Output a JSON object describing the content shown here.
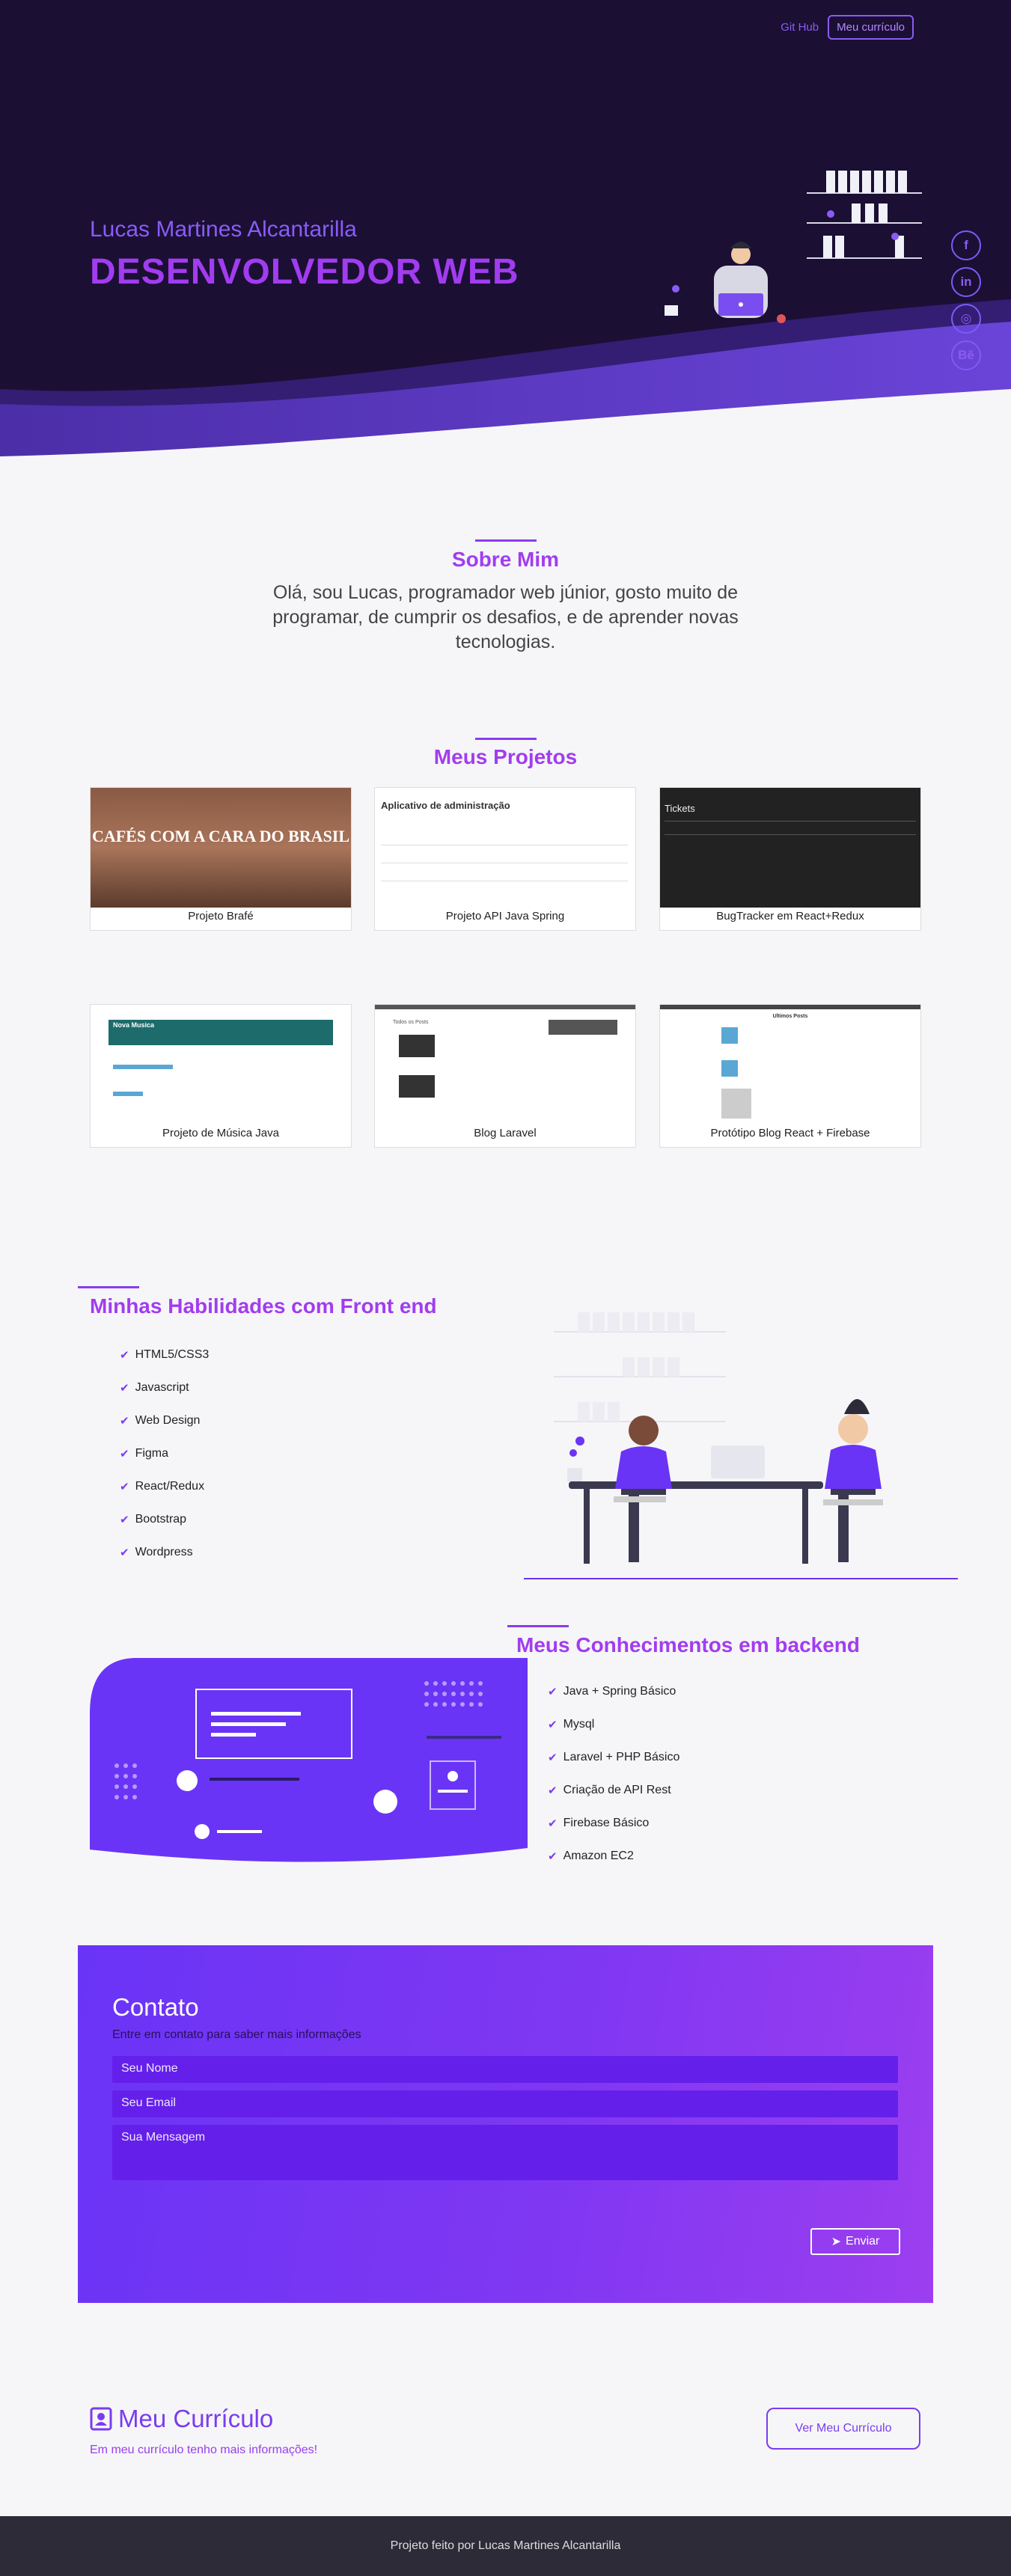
{
  "nav": {
    "github": "Git Hub",
    "curriculo": "Meu currículo"
  },
  "hero": {
    "name": "Lucas Martines Alcantarilla",
    "title": "DESENVOLVEDOR WEB"
  },
  "social": [
    {
      "label": "f",
      "icon": "facebook-icon"
    },
    {
      "label": "in",
      "icon": "linkedin-icon"
    },
    {
      "label": "◎",
      "icon": "whatsapp-icon"
    },
    {
      "label": "Bē",
      "icon": "behance-icon"
    }
  ],
  "about": {
    "title": "Sobre Mim",
    "text": "Olá, sou Lucas, programador web júnior, gosto muito de programar, de cumprir os desafios, e de aprender novas tecnologias."
  },
  "projects": {
    "title": "Meus Projetos",
    "items": [
      {
        "caption": "Projeto Brafé",
        "thumb_text": "CAFÉS COM A CARA DO BRASIL"
      },
      {
        "caption": "Projeto API Java Spring",
        "thumb_text": "Aplicativo de administração"
      },
      {
        "caption": "BugTracker em React+Redux",
        "thumb_text": "Tickets"
      },
      {
        "caption": "Projeto de Música Java",
        "thumb_text": "Nova Musica"
      },
      {
        "caption": "Blog Laravel",
        "thumb_text": "Todos os Posts"
      },
      {
        "caption": "Protótipo Blog React + Firebase",
        "thumb_text": "Ultimos Posts"
      }
    ]
  },
  "frontend": {
    "title": "Minhas Habilidades com Front end",
    "skills": [
      "HTML5/CSS3",
      "Javascript",
      "Web Design",
      "Figma",
      "React/Redux",
      "Bootstrap",
      "Wordpress"
    ]
  },
  "backend": {
    "title": "Meus Conhecimentos em backend",
    "skills": [
      "Java + Spring Básico",
      "Mysql",
      "Laravel + PHP Básico",
      "Criação de API Rest",
      "Firebase Básico",
      "Amazon EC2"
    ]
  },
  "contact": {
    "title": "Contato",
    "subtitle": "Entre em contato para saber mais informações",
    "name_placeholder": "Seu Nome",
    "email_placeholder": "Seu Email",
    "message_placeholder": "Sua Mensagem",
    "send": "Enviar"
  },
  "cv": {
    "title": "Meu Currículo",
    "subtitle": "Em meu currículo tenho mais informações!",
    "button": "Ver Meu Currículo"
  },
  "footer": {
    "text": "Projeto feito por Lucas Martines Alcantarilla"
  },
  "colors": {
    "accent": "#8a3cf0",
    "hero_bg": "#1b0f34",
    "wave": "#5a35c9",
    "footer": "#2d2b38"
  }
}
